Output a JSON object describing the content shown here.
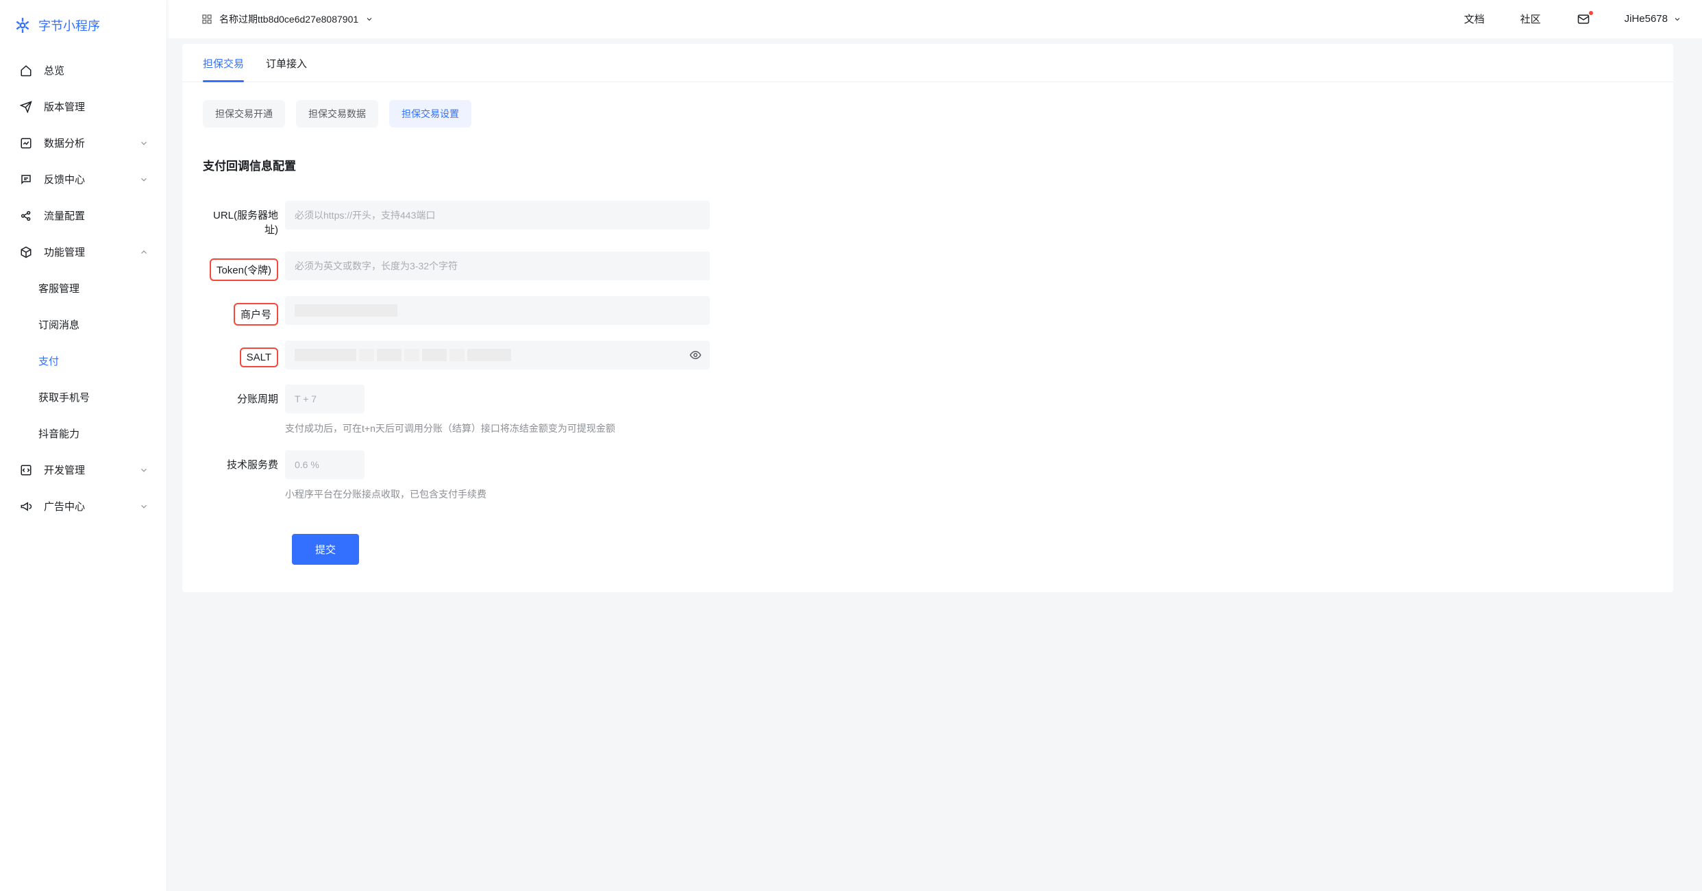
{
  "brand": {
    "name": "字节小程序"
  },
  "sidebar": {
    "items": [
      {
        "label": "总览",
        "icon": "home"
      },
      {
        "label": "版本管理",
        "icon": "send"
      },
      {
        "label": "数据分析",
        "icon": "chart",
        "expandable": true
      },
      {
        "label": "反馈中心",
        "icon": "message",
        "expandable": true
      },
      {
        "label": "流量配置",
        "icon": "share"
      },
      {
        "label": "功能管理",
        "icon": "cube",
        "expandable": true,
        "expanded": true,
        "children": [
          {
            "label": "客服管理"
          },
          {
            "label": "订阅消息"
          },
          {
            "label": "支付",
            "active": true
          },
          {
            "label": "获取手机号"
          },
          {
            "label": "抖音能力"
          }
        ]
      },
      {
        "label": "开发管理",
        "icon": "code",
        "expandable": true
      },
      {
        "label": "广告中心",
        "icon": "megaphone",
        "expandable": true
      }
    ]
  },
  "topbar": {
    "app_name": "名称过期ttb8d0ce6d27e8087901",
    "links": {
      "docs": "文档",
      "community": "社区"
    },
    "user": "JiHe5678"
  },
  "tabs": [
    {
      "label": "担保交易",
      "active": true
    },
    {
      "label": "订单接入"
    }
  ],
  "subtabs": [
    {
      "label": "担保交易开通"
    },
    {
      "label": "担保交易数据"
    },
    {
      "label": "担保交易设置",
      "active": true
    }
  ],
  "form": {
    "section_title": "支付回调信息配置",
    "url": {
      "label": "URL(服务器地址)",
      "placeholder": "必须以https://开头，支持443端口",
      "value": ""
    },
    "token": {
      "label": "Token(令牌)",
      "placeholder": "必须为英文或数字，长度为3-32个字符",
      "value": ""
    },
    "merchant": {
      "label": "商户号",
      "value": ""
    },
    "salt": {
      "label": "SALT",
      "value": ""
    },
    "period": {
      "label": "分账周期",
      "value": "T + 7",
      "help": "支付成功后，可在t+n天后可调用分账（结算）接口将冻结金额变为可提现金额"
    },
    "fee": {
      "label": "技术服务费",
      "value": "0.6 %",
      "help": "小程序平台在分账接点收取，已包含支付手续费"
    },
    "submit": "提交"
  }
}
